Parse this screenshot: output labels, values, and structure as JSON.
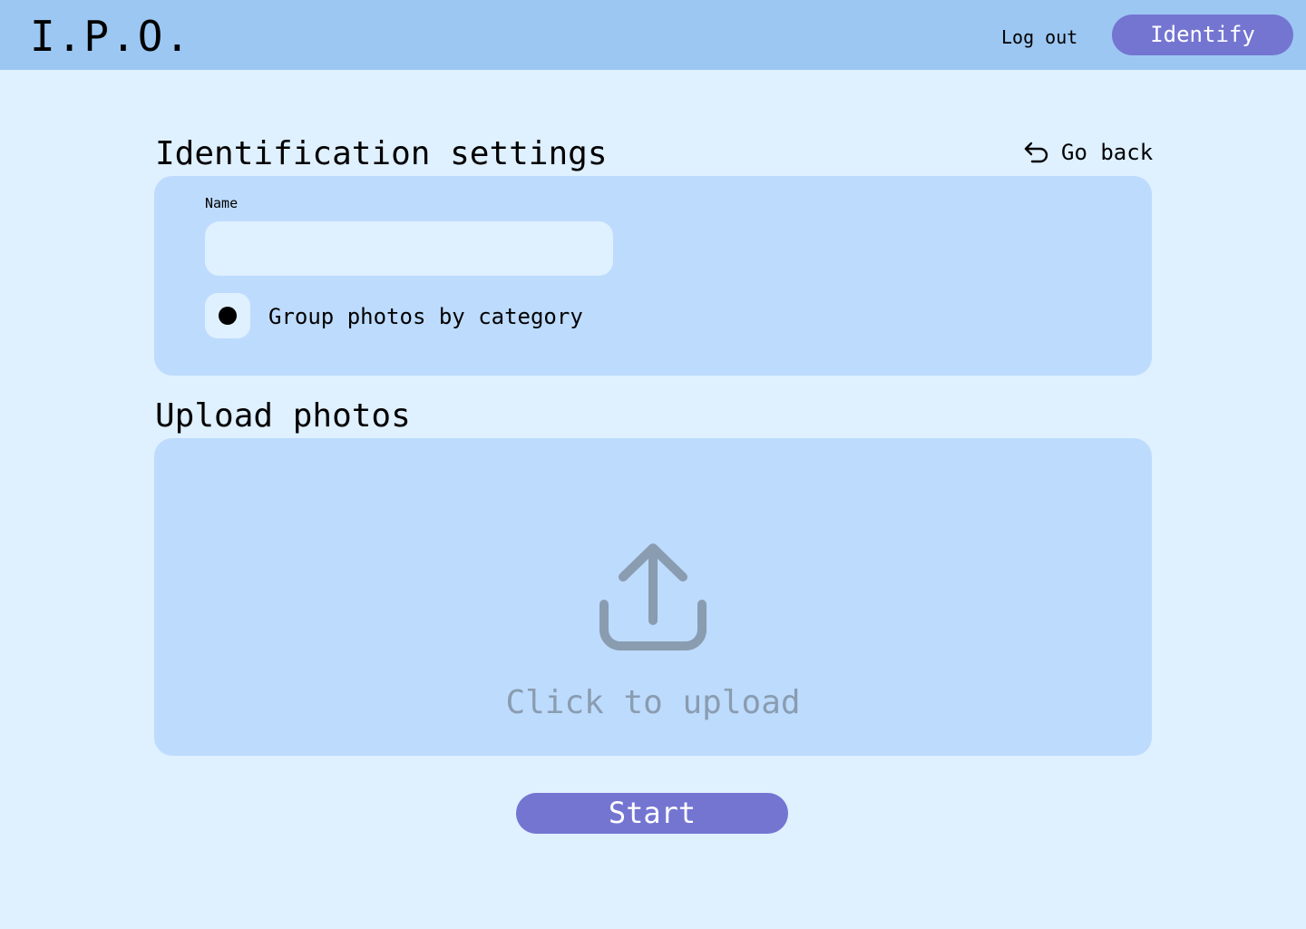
{
  "header": {
    "logo": "I.P.O.",
    "logout_label": "Log out",
    "identify_label": "Identify"
  },
  "settings": {
    "title": "Identification settings",
    "go_back_label": "Go back",
    "go_back_icon": "undo-arrow-icon",
    "name_label": "Name",
    "name_value": "",
    "name_placeholder": "",
    "group_option_label": "Group photos by category",
    "group_option_checked": true
  },
  "upload": {
    "title": "Upload photos",
    "icon": "upload-icon",
    "prompt": "Click to upload"
  },
  "actions": {
    "start_label": "Start"
  },
  "colors": {
    "page_background": "#dff0ff",
    "header_background": "#9cc7f2",
    "panel_background": "#bddbfd",
    "accent_button": "#7475d1",
    "muted_icon": "#8a9cb0"
  }
}
